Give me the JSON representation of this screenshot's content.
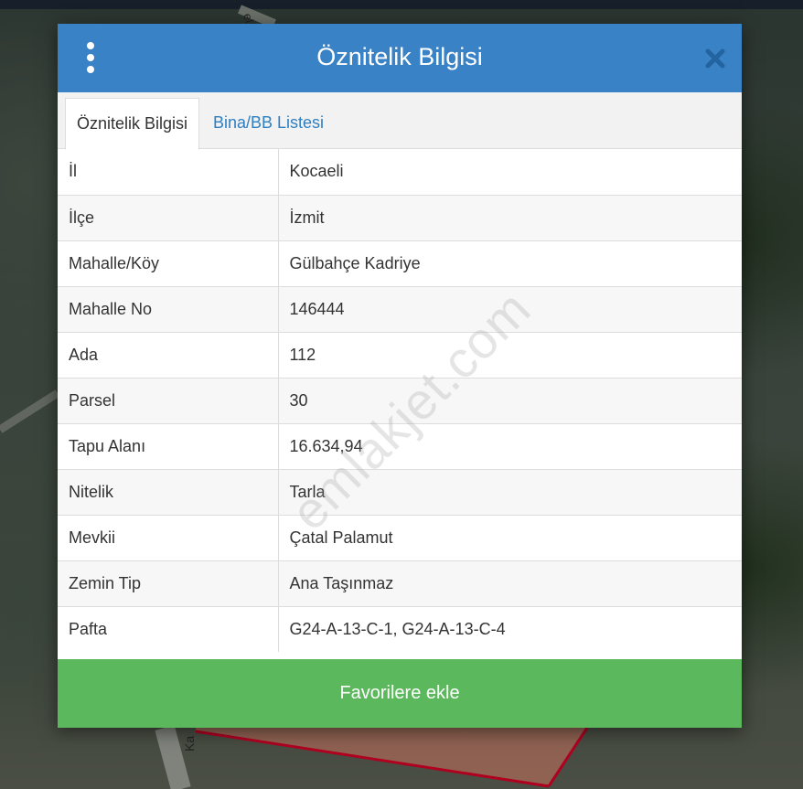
{
  "colors": {
    "header_bg": "#3a82c6",
    "tab_link": "#2f7fc1",
    "primary_button": "#5cb85c",
    "parcel_outline": "#b00020"
  },
  "modal": {
    "title": "Öznitelik Bilgisi",
    "menu_icon": "vertical-dots-icon",
    "close_icon": "close-icon"
  },
  "tabs": [
    {
      "label": "Öznitelik Bilgisi",
      "active": true
    },
    {
      "label": "Bina/BB Listesi",
      "active": false
    }
  ],
  "attributes": [
    {
      "key": "İl",
      "value": "Kocaeli"
    },
    {
      "key": "İlçe",
      "value": "İzmit"
    },
    {
      "key": "Mahalle/Köy",
      "value": "Gülbahçe Kadriye"
    },
    {
      "key": "Mahalle No",
      "value": "146444"
    },
    {
      "key": "Ada",
      "value": "112"
    },
    {
      "key": "Parsel",
      "value": "30"
    },
    {
      "key": "Tapu Alanı",
      "value": "16.634,94"
    },
    {
      "key": "Nitelik",
      "value": "Tarla"
    },
    {
      "key": "Mevkii",
      "value": "Çatal Palamut"
    },
    {
      "key": "Zemin Tip",
      "value": "Ana Taşınmaz"
    },
    {
      "key": "Pafta",
      "value": "G24-A-13-C-1, G24-A-13-C-4"
    }
  ],
  "actions": {
    "favorite_label": "Favorilere ekle"
  },
  "watermark": "emlakjet.com",
  "map_labels": {
    "road_label_top": "el",
    "road_label_bottom": "Ka"
  }
}
